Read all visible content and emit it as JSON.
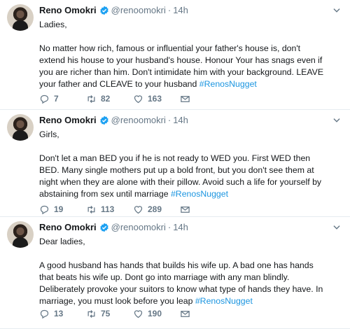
{
  "tweets": [
    {
      "name": "Reno Omokri",
      "handle": "@renoomokri",
      "time": "14h",
      "greeting": "Ladies,",
      "text": "No matter how rich, famous or influential your father's house is, don't extend his house to your husband's house. Honour Your has snags even if you are richer than him. Don't intimidate him with your background. LEAVE your father and CLEAVE to your husband",
      "hashtag": "#RenosNugget",
      "replies": "7",
      "retweets": "82",
      "likes": "163"
    },
    {
      "name": "Reno Omokri",
      "handle": "@renoomokri",
      "time": "14h",
      "greeting": "Girls,",
      "text": "Don't let a man BED you if he is not ready to WED you. First WED then BED. Many single mothers put up a bold front, but you don't see them at night when they are alone with their pillow. Avoid such a life for yourself by abstaining from sex until marriage",
      "hashtag": "#RenosNugget",
      "replies": "19",
      "retweets": "113",
      "likes": "289"
    },
    {
      "name": "Reno Omokri",
      "handle": "@renoomokri",
      "time": "14h",
      "greeting": "Dear ladies,",
      "text": "A good husband has hands that builds his wife up. A bad one has hands that beats his wife up. Dont go into marriage with any man blindly. Deliberately provoke your suitors to know what type of hands they have. In marriage, you must look before you leap",
      "hashtag": "#RenosNugget",
      "replies": "13",
      "retweets": "75",
      "likes": "190"
    }
  ],
  "icons": {
    "verified": "verified-badge-icon",
    "reply": "reply-icon",
    "retweet": "retweet-icon",
    "like": "heart-icon",
    "message": "direct-message-icon",
    "caret": "chevron-down-icon"
  },
  "colors": {
    "text": "#14171a",
    "muted": "#657786",
    "link": "#1b95e0",
    "verified": "#1da1f2"
  }
}
